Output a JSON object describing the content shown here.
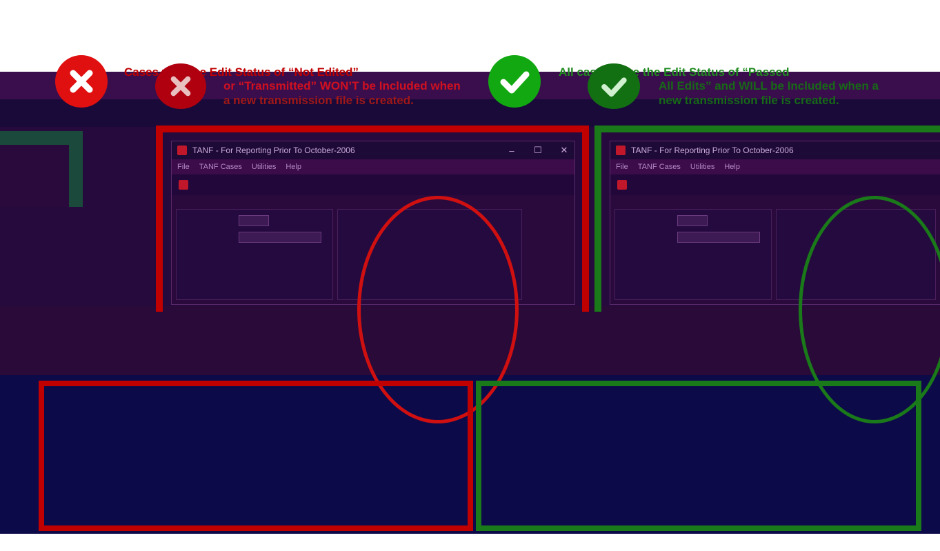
{
  "legend": {
    "bad": {
      "icon": "red-x-icon",
      "text": "Cases with the Edit Status of “Not Edited” or “Transmitted” WON’T be Included when a new transmission file is created.",
      "line1": "Cases with the Edit Status of “Not Edited”",
      "line2": "or “Transmitted” WON’T be Included when",
      "line3": "a new transmission file is created.",
      "color": "#c00000"
    },
    "good": {
      "icon": "green-check-icon",
      "text": "All cases have the Edit Status of “Passed All Edits” and WILL be Included when a new transmission file is created.",
      "line1": "All cases have the Edit Status of “Passed",
      "line2": "All Edits” and WILL be Included when a",
      "line3": "new transmission file is created.",
      "color": "#1f8a1f"
    }
  },
  "windows": {
    "left": {
      "title": "TANF -  For Reporting  Prior To October-2006",
      "menu": [
        "File",
        "TANF Cases",
        "Utilities",
        "Help"
      ],
      "frame_color": "#c00000"
    },
    "right": {
      "title": "TANF -  For Reporting  Prior To October-2006",
      "menu": [
        "File",
        "TANF Cases",
        "Utilities",
        "Help"
      ],
      "frame_color": "#1a7a1a"
    }
  },
  "colors": {
    "glitch_purple": "#3a0e4c",
    "glitch_navy": "#0d0a4a",
    "bad_red": "#c00000",
    "good_green": "#1a7a1a"
  }
}
